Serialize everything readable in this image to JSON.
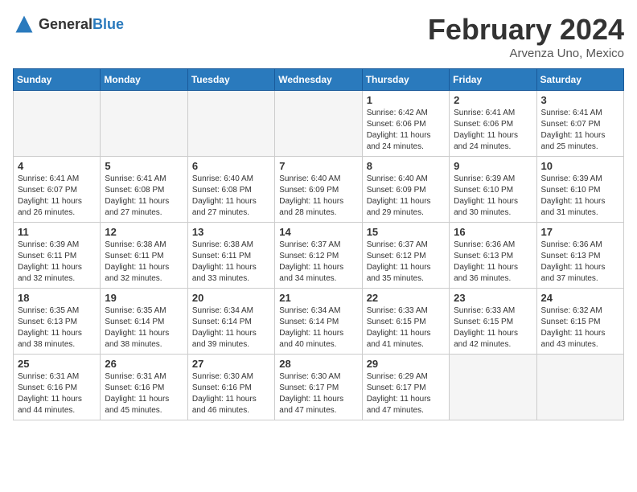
{
  "header": {
    "logo_general": "General",
    "logo_blue": "Blue",
    "month_title": "February 2024",
    "location": "Arvenza Uno, Mexico"
  },
  "calendar": {
    "weekdays": [
      "Sunday",
      "Monday",
      "Tuesday",
      "Wednesday",
      "Thursday",
      "Friday",
      "Saturday"
    ],
    "weeks": [
      [
        {
          "day": "",
          "info": ""
        },
        {
          "day": "",
          "info": ""
        },
        {
          "day": "",
          "info": ""
        },
        {
          "day": "",
          "info": ""
        },
        {
          "day": "1",
          "info": "Sunrise: 6:42 AM\nSunset: 6:06 PM\nDaylight: 11 hours and 24 minutes."
        },
        {
          "day": "2",
          "info": "Sunrise: 6:41 AM\nSunset: 6:06 PM\nDaylight: 11 hours and 24 minutes."
        },
        {
          "day": "3",
          "info": "Sunrise: 6:41 AM\nSunset: 6:07 PM\nDaylight: 11 hours and 25 minutes."
        }
      ],
      [
        {
          "day": "4",
          "info": "Sunrise: 6:41 AM\nSunset: 6:07 PM\nDaylight: 11 hours and 26 minutes."
        },
        {
          "day": "5",
          "info": "Sunrise: 6:41 AM\nSunset: 6:08 PM\nDaylight: 11 hours and 27 minutes."
        },
        {
          "day": "6",
          "info": "Sunrise: 6:40 AM\nSunset: 6:08 PM\nDaylight: 11 hours and 27 minutes."
        },
        {
          "day": "7",
          "info": "Sunrise: 6:40 AM\nSunset: 6:09 PM\nDaylight: 11 hours and 28 minutes."
        },
        {
          "day": "8",
          "info": "Sunrise: 6:40 AM\nSunset: 6:09 PM\nDaylight: 11 hours and 29 minutes."
        },
        {
          "day": "9",
          "info": "Sunrise: 6:39 AM\nSunset: 6:10 PM\nDaylight: 11 hours and 30 minutes."
        },
        {
          "day": "10",
          "info": "Sunrise: 6:39 AM\nSunset: 6:10 PM\nDaylight: 11 hours and 31 minutes."
        }
      ],
      [
        {
          "day": "11",
          "info": "Sunrise: 6:39 AM\nSunset: 6:11 PM\nDaylight: 11 hours and 32 minutes."
        },
        {
          "day": "12",
          "info": "Sunrise: 6:38 AM\nSunset: 6:11 PM\nDaylight: 11 hours and 32 minutes."
        },
        {
          "day": "13",
          "info": "Sunrise: 6:38 AM\nSunset: 6:11 PM\nDaylight: 11 hours and 33 minutes."
        },
        {
          "day": "14",
          "info": "Sunrise: 6:37 AM\nSunset: 6:12 PM\nDaylight: 11 hours and 34 minutes."
        },
        {
          "day": "15",
          "info": "Sunrise: 6:37 AM\nSunset: 6:12 PM\nDaylight: 11 hours and 35 minutes."
        },
        {
          "day": "16",
          "info": "Sunrise: 6:36 AM\nSunset: 6:13 PM\nDaylight: 11 hours and 36 minutes."
        },
        {
          "day": "17",
          "info": "Sunrise: 6:36 AM\nSunset: 6:13 PM\nDaylight: 11 hours and 37 minutes."
        }
      ],
      [
        {
          "day": "18",
          "info": "Sunrise: 6:35 AM\nSunset: 6:13 PM\nDaylight: 11 hours and 38 minutes."
        },
        {
          "day": "19",
          "info": "Sunrise: 6:35 AM\nSunset: 6:14 PM\nDaylight: 11 hours and 38 minutes."
        },
        {
          "day": "20",
          "info": "Sunrise: 6:34 AM\nSunset: 6:14 PM\nDaylight: 11 hours and 39 minutes."
        },
        {
          "day": "21",
          "info": "Sunrise: 6:34 AM\nSunset: 6:14 PM\nDaylight: 11 hours and 40 minutes."
        },
        {
          "day": "22",
          "info": "Sunrise: 6:33 AM\nSunset: 6:15 PM\nDaylight: 11 hours and 41 minutes."
        },
        {
          "day": "23",
          "info": "Sunrise: 6:33 AM\nSunset: 6:15 PM\nDaylight: 11 hours and 42 minutes."
        },
        {
          "day": "24",
          "info": "Sunrise: 6:32 AM\nSunset: 6:15 PM\nDaylight: 11 hours and 43 minutes."
        }
      ],
      [
        {
          "day": "25",
          "info": "Sunrise: 6:31 AM\nSunset: 6:16 PM\nDaylight: 11 hours and 44 minutes."
        },
        {
          "day": "26",
          "info": "Sunrise: 6:31 AM\nSunset: 6:16 PM\nDaylight: 11 hours and 45 minutes."
        },
        {
          "day": "27",
          "info": "Sunrise: 6:30 AM\nSunset: 6:16 PM\nDaylight: 11 hours and 46 minutes."
        },
        {
          "day": "28",
          "info": "Sunrise: 6:30 AM\nSunset: 6:17 PM\nDaylight: 11 hours and 47 minutes."
        },
        {
          "day": "29",
          "info": "Sunrise: 6:29 AM\nSunset: 6:17 PM\nDaylight: 11 hours and 47 minutes."
        },
        {
          "day": "",
          "info": ""
        },
        {
          "day": "",
          "info": ""
        }
      ]
    ]
  }
}
